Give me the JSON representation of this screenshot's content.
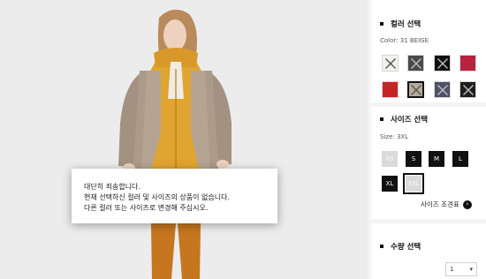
{
  "alert": {
    "line1": "대단히 죄송합니다.",
    "line2": "현재 선택하신 컬러 및 사이즈의 상품이 없습니다.",
    "line3": "다른 컬러 또는 사이즈로 변경해 주십시오."
  },
  "color_section": {
    "title": "컬러 선택",
    "selected_label": "Color: 31 BEIGE",
    "swatches": [
      {
        "name": "white",
        "color": "#f3f1ec",
        "available": false,
        "selected": false
      },
      {
        "name": "dark-grey-pattern",
        "color": "#4a4a4a",
        "available": false,
        "selected": false
      },
      {
        "name": "black",
        "color": "#0f0f0f",
        "available": false,
        "selected": false
      },
      {
        "name": "wine",
        "color": "#b7233f",
        "available": true,
        "selected": false
      },
      {
        "name": "red",
        "color": "#c42424",
        "available": true,
        "selected": false
      },
      {
        "name": "beige",
        "color": "#b9ab9c",
        "available": false,
        "selected": true
      },
      {
        "name": "navy-grey",
        "color": "#4f5266",
        "available": false,
        "selected": false
      },
      {
        "name": "charcoal",
        "color": "#1e1e1e",
        "available": false,
        "selected": false
      }
    ]
  },
  "size_section": {
    "title": "사이즈 선택",
    "selected_label": "Size: 3XL",
    "sizes": [
      {
        "label": "XS",
        "available": false,
        "selected": false
      },
      {
        "label": "S",
        "available": true,
        "selected": false
      },
      {
        "label": "M",
        "available": true,
        "selected": false
      },
      {
        "label": "L",
        "available": true,
        "selected": false
      },
      {
        "label": "XL",
        "available": true,
        "selected": false
      },
      {
        "label": "3XL",
        "available": false,
        "selected": true
      }
    ],
    "chart_link": "사이즈 조견표",
    "chart_link_icon": "arrow-right-circle-icon"
  },
  "quantity_section": {
    "title": "수량 선택",
    "value": "1",
    "dropdown_icon": "chevron-down-icon"
  },
  "colors": {
    "panel_divider": "#f4f4f4",
    "photo_bg": "#ececec"
  }
}
